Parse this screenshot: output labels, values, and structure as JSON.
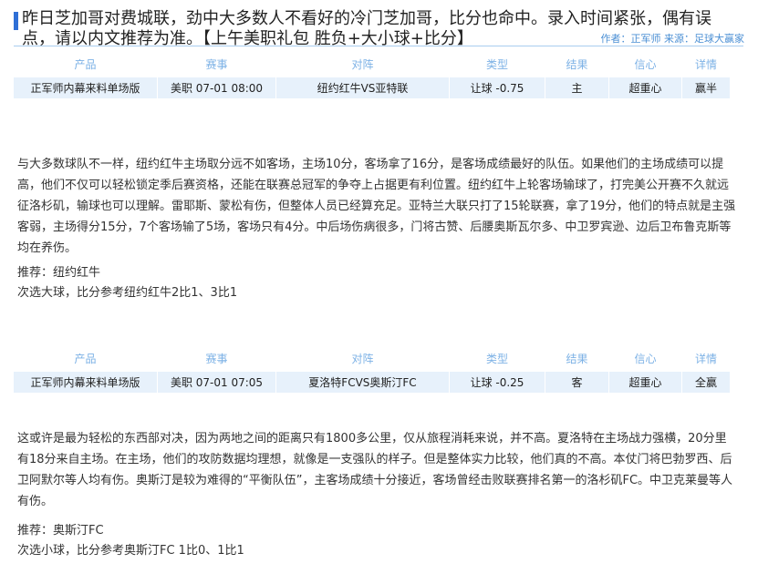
{
  "article": {
    "headline": "昨日芝加哥对费城联，劲中大多数人不看好的冷门芝加哥，比分也命中。录入时间紧张，偶有误点，请以内文推荐为准。【上午美职礼包 胜负+大小球+比分】",
    "author": "作者：正军师 来源：足球大赢家"
  },
  "table_headers": [
    "产品",
    "赛事",
    "对阵",
    "类型",
    "结果",
    "信心",
    "详情"
  ],
  "matches": [
    {
      "row": [
        "正军师内幕来料单场版",
        "美职 07-01 08:00",
        "纽约红牛VS亚特联",
        "让球 -0.75",
        "主",
        "超重心",
        "赢半"
      ],
      "analysis": "与大多数球队不一样，纽约红牛主场取分远不如客场，主场10分，客场拿了16分，是客场成绩最好的队伍。如果他们的主场成绩可以提高，他们不仅可以轻松锁定季后赛资格，还能在联赛总冠军的争夺上占据更有利位置。纽约红牛上轮客场输球了，打完美公开赛不久就远征洛杉矶，输球也可以理解。雷耶斯、蒙松有伤，但整体人员已经算充足。亚特兰大联只打了15轮联赛，拿了19分，他们的特点就是主强客弱，主场得分15分，7个客场输了5场，客场只有4分。中后场伤病很多，门将古赞、后腰奥斯瓦尔多、中卫罗宾逊、边后卫布鲁克斯等均在养伤。",
      "recommend": "推荐：纽约红牛",
      "secondary": "次选大球，比分参考纽约红牛2比1、3比1"
    },
    {
      "row": [
        "正军师内幕来料单场版",
        "美职 07-01 07:05",
        "夏洛特FCVS奥斯汀FC",
        "让球 -0.25",
        "客",
        "超重心",
        "全赢"
      ],
      "analysis": "这或许是最为轻松的东西部对决，因为两地之间的距离只有1800多公里，仅从旅程消耗来说，并不高。夏洛特在主场战力强横，20分里有18分来自主场。在主场，他们的攻防数据均理想，就像是一支强队的样子。但是整体实力比较，他们真的不高。本仗门将巴勃罗西、后卫阿默尔等人均有伤。奥斯汀是较为难得的“平衡队伍”，主客场成绩十分接近，客场曾经击败联赛排名第一的洛杉矶FC。中卫克莱曼等人有伤。",
      "recommend": "推荐：奥斯汀FC",
      "secondary": "次选小球，比分参考奥斯汀FC 1比0、1比1"
    }
  ],
  "colors": {
    "accent_bar": "#2f6fd6",
    "header_text": "#7db2e6",
    "row_bg": "#e7f1fb",
    "author_text": "#4b8fd4"
  }
}
